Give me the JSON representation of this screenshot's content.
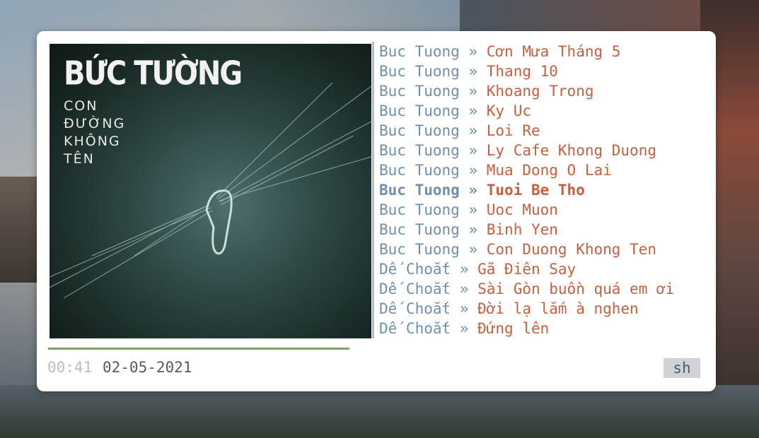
{
  "album": {
    "title": "BỨC TƯỜNG",
    "subtitle_lines": [
      "CON",
      "ĐƯỜNG",
      "KHÔNG",
      "TÊN"
    ]
  },
  "tracks": [
    {
      "artist": "Buc Tuong",
      "separator": "»",
      "song": "Cơn Mưa Tháng 5"
    },
    {
      "artist": "Buc Tuong",
      "separator": "»",
      "song": "Thang 10"
    },
    {
      "artist": "Buc Tuong",
      "separator": "»",
      "song": "Khoang Trong"
    },
    {
      "artist": "Buc Tuong",
      "separator": "»",
      "song": "Ky Uc"
    },
    {
      "artist": "Buc Tuong",
      "separator": "»",
      "song": "Loi Re"
    },
    {
      "artist": "Buc Tuong",
      "separator": "»",
      "song": "Ly Cafe Khong Duong"
    },
    {
      "artist": "Buc Tuong",
      "separator": "»",
      "song": "Mua Dong O Lai"
    },
    {
      "artist": "Buc Tuong",
      "separator": "»",
      "song": "Tuoi Be Tho",
      "active": true
    },
    {
      "artist": "Buc Tuong",
      "separator": "»",
      "song": "Uoc Muon"
    },
    {
      "artist": "Buc Tuong",
      "separator": "»",
      "song": "Binh Yen"
    },
    {
      "artist": "Buc Tuong",
      "separator": "»",
      "song": "Con Duong Khong Ten"
    },
    {
      "artist": "Dế Choắt",
      "separator": "»",
      "song": "Gã Điên Say"
    },
    {
      "artist": "Dế Choắt",
      "separator": "»",
      "song": "Sài Gòn buồn quá em ơi"
    },
    {
      "artist": "Dế Choắt",
      "separator": "»",
      "song": "Đời lạ lắm à nghen"
    },
    {
      "artist": "Dế Choắt",
      "separator": "»",
      "song": "Đứng lên"
    }
  ],
  "player": {
    "elapsed": "00:41",
    "date": "02-05-2021",
    "progress_fraction": 1.0,
    "shell_button_label": "sh"
  },
  "colors": {
    "artist": "#6f8fae",
    "song": "#c7603f",
    "progress": "#7aa562"
  }
}
